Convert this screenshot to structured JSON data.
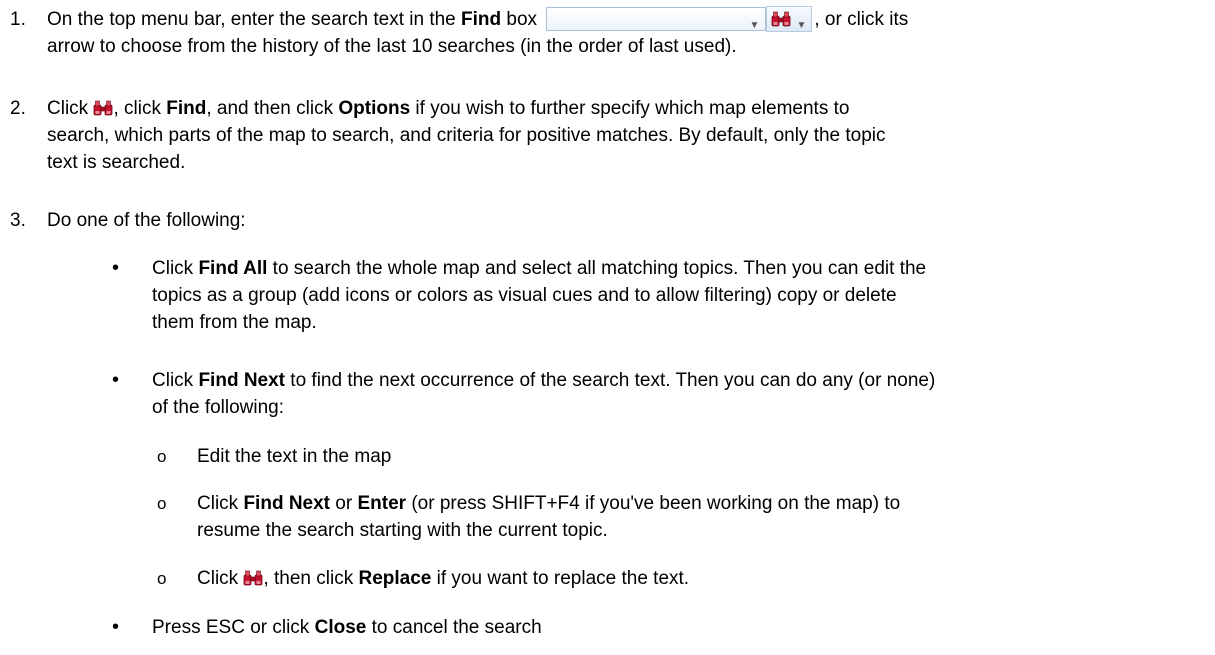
{
  "steps": [
    {
      "number": "1.",
      "parts": {
        "a": "On the top menu bar, enter the search text in the ",
        "b1": "Find",
        "c": " box",
        "d": ", or click its",
        "line2": "arrow to choose from the history of the last 10 searches (in the order of last used)."
      }
    },
    {
      "number": "2.",
      "parts": {
        "a": "Click ",
        "b": ", click ",
        "b1": "Find",
        "c": ", and then click ",
        "b2": "Options",
        "d": " if you wish to further specify which map elements to",
        "line2": "search, which parts of the map to search, and criteria for positive matches. By default, only the topic",
        "line3": "text is searched."
      }
    },
    {
      "number": "3.",
      "text": "Do one of the following:"
    }
  ],
  "bullets": [
    {
      "symbol": "•",
      "a": "Click ",
      "b1": "Find All",
      "c": " to search the whole map and select all matching topics. Then you can edit the",
      "line2": "topics as a group (add icons or colors as visual cues and to allow filtering) copy or delete",
      "line3": "them from the map."
    },
    {
      "symbol": "•",
      "a": "Click ",
      "b1": "Find Next",
      "c": " to find the next occurrence of the search text. Then you can do any (or none)",
      "line2": "of the following:"
    },
    {
      "symbol": "•",
      "a": "Press ESC or click ",
      "b1": "Close",
      "c": " to cancel the search"
    }
  ],
  "subitems": [
    {
      "symbol": "o",
      "text": "Edit the text in the map"
    },
    {
      "symbol": "o",
      "a": "Click ",
      "b1": "Find Next",
      "c": " or ",
      "b2": "Enter",
      "d": " (or press SHIFT+F4 if you've been working on the map) to",
      "line2": "resume the search starting with the current topic."
    },
    {
      "symbol": "o",
      "a": "Click ",
      "c": ", then click ",
      "b1": "Replace",
      "d": " if you want to replace the text."
    }
  ],
  "icons": {
    "binoculars": "binoculars-icon",
    "dropdown": "chevron-down-icon"
  },
  "colors": {
    "binoculars_fill": "#c8102e",
    "box_border": "#a9bfd6"
  }
}
